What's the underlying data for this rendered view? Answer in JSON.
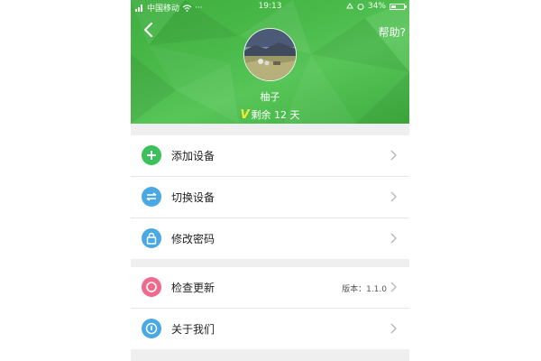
{
  "status_bar": {
    "carrier": "中国移动",
    "time": "19:13",
    "battery": "34%"
  },
  "header": {
    "help_label": "帮助?",
    "username": "柚子",
    "vip_badge": "V",
    "vip_remaining": "剩余 12 天"
  },
  "menu_group_1": [
    {
      "label": "添加设备",
      "icon": "plus-icon",
      "color": "#3cc05a"
    },
    {
      "label": "切换设备",
      "icon": "switch-icon",
      "color": "#4aa9e3"
    },
    {
      "label": "修改密码",
      "icon": "lock-icon",
      "color": "#4aa9e3"
    }
  ],
  "menu_group_2": [
    {
      "label": "检查更新",
      "icon": "update-icon",
      "color": "#ef6b8e",
      "value": "版本：1.1.0"
    },
    {
      "label": "关于我们",
      "icon": "info-icon",
      "color": "#4aa9e3"
    }
  ],
  "colors": {
    "header_green": "#49b94a",
    "background": "#efefef"
  }
}
